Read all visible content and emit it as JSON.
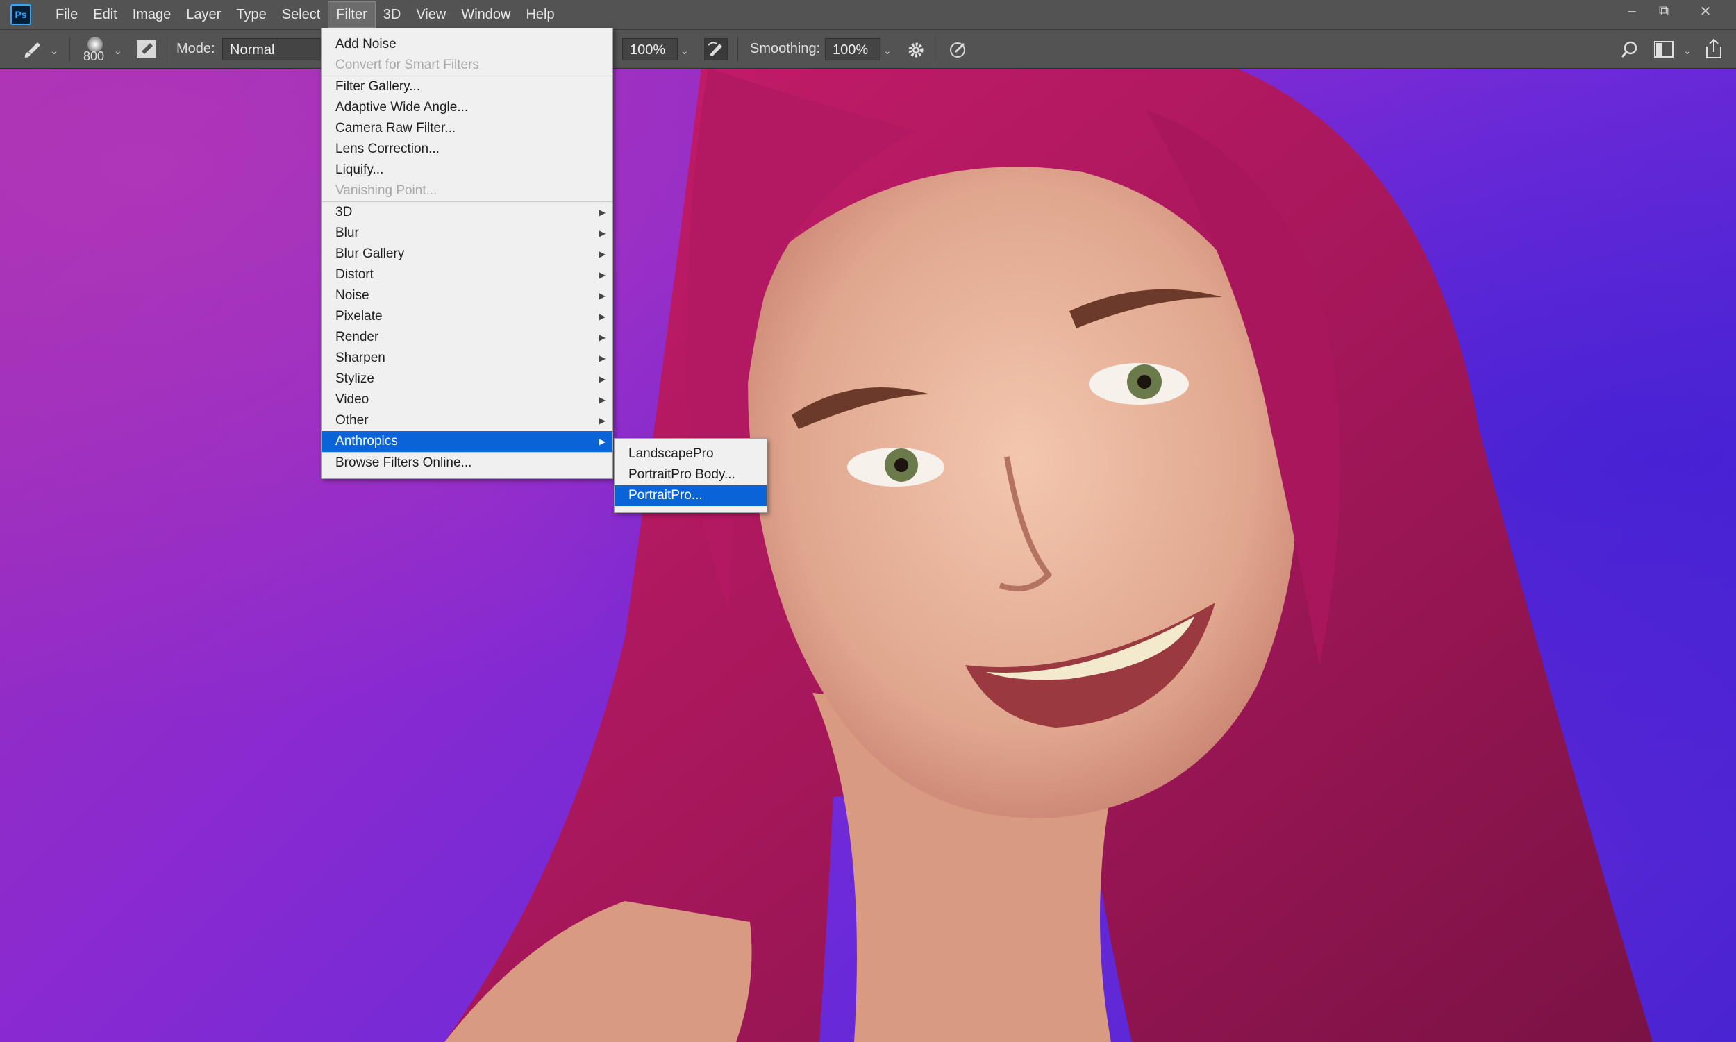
{
  "app": {
    "logo": "Ps"
  },
  "menubar": {
    "items": [
      "File",
      "Edit",
      "Image",
      "Layer",
      "Type",
      "Select",
      "Filter",
      "3D",
      "View",
      "Window",
      "Help"
    ],
    "active": "Filter"
  },
  "window_controls": {
    "minimize": "–",
    "restore": "⧉",
    "close": "✕"
  },
  "options_bar": {
    "brush_size": "800",
    "mode_label": "Mode:",
    "mode_value": "Normal",
    "opacity_value": "100%",
    "smoothing_label": "Smoothing:",
    "smoothing_value": "100%"
  },
  "filter_menu": {
    "items": [
      {
        "label": "Add Noise",
        "disabled": false
      },
      {
        "label": "Convert for Smart Filters",
        "disabled": true
      },
      {
        "label": "Filter Gallery...",
        "disabled": false
      },
      {
        "label": "Adaptive Wide Angle...",
        "disabled": false
      },
      {
        "label": "Camera Raw Filter...",
        "disabled": false
      },
      {
        "label": "Lens Correction...",
        "disabled": false
      },
      {
        "label": "Liquify...",
        "disabled": false
      },
      {
        "label": "Vanishing Point...",
        "disabled": true
      },
      {
        "label": "3D",
        "submenu": true
      },
      {
        "label": "Blur",
        "submenu": true
      },
      {
        "label": "Blur Gallery",
        "submenu": true
      },
      {
        "label": "Distort",
        "submenu": true
      },
      {
        "label": "Noise",
        "submenu": true
      },
      {
        "label": "Pixelate",
        "submenu": true
      },
      {
        "label": "Render",
        "submenu": true
      },
      {
        "label": "Sharpen",
        "submenu": true
      },
      {
        "label": "Stylize",
        "submenu": true
      },
      {
        "label": "Video",
        "submenu": true
      },
      {
        "label": "Other",
        "submenu": true
      },
      {
        "label": "Anthropics",
        "submenu": true,
        "highlighted": true
      },
      {
        "label": "Browse Filters Online...",
        "disabled": false
      }
    ]
  },
  "anthropics_submenu": {
    "items": [
      {
        "label": "LandscapePro"
      },
      {
        "label": "PortraitPro Body..."
      },
      {
        "label": "PortraitPro...",
        "highlighted": true
      }
    ]
  },
  "colors": {
    "ui_bg": "#535353",
    "menu_bg": "#f0f0f0",
    "highlight": "#0a64d8",
    "hair": "#b8195e"
  },
  "icons": [
    "brush-icon",
    "brush-preset-icon",
    "toggle-brush-panel-icon",
    "airbrush-icon",
    "settings-gear-icon",
    "symmetry-icon",
    "search-icon",
    "workspace-icon",
    "share-icon"
  ]
}
